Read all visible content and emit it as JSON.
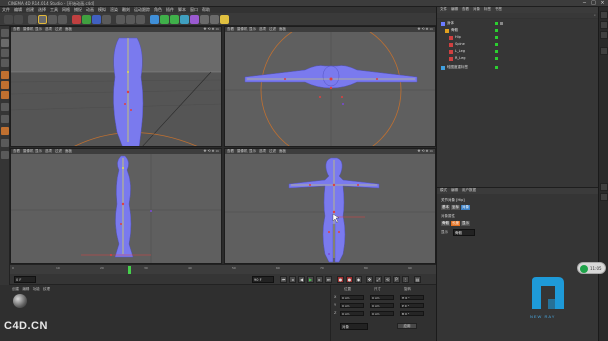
{
  "window": {
    "title": "CINEMA 4D R14.014 Studio - [开始动画.c4d]",
    "controls": [
      "−",
      "□",
      "×"
    ]
  },
  "menubar": [
    "文件",
    "编辑",
    "创建",
    "选择",
    "工具",
    "网格",
    "捕捉",
    "动画",
    "模拟",
    "渲染",
    "雕刻",
    "运动跟踪",
    "角色",
    "插件",
    "脚本",
    "窗口",
    "帮助"
  ],
  "viewports": [
    {
      "name": "透视视图",
      "menus": [
        "查看",
        "摄像机",
        "显示",
        "选项",
        "过滤",
        "面板"
      ]
    },
    {
      "name": "顶视图",
      "menus": [
        "查看",
        "摄像机",
        "显示",
        "选项",
        "过滤",
        "面板"
      ]
    },
    {
      "name": "右视图",
      "menus": [
        "查看",
        "摄像机",
        "显示",
        "选项",
        "过滤",
        "面板"
      ]
    },
    {
      "name": "正视图",
      "menus": [
        "查看",
        "摄像机",
        "显示",
        "选项",
        "过滤",
        "面板"
      ]
    }
  ],
  "timeline": {
    "ticks": [
      "0",
      "10",
      "20",
      "30",
      "40",
      "50",
      "60",
      "70",
      "80",
      "90"
    ],
    "playhead_fraction": 0.28,
    "start_field": "0 F",
    "end_field": "90 F",
    "current_field": "0 F"
  },
  "material_manager": {
    "menus": [
      "创建",
      "编辑",
      "功能",
      "纹理"
    ]
  },
  "coordinates": {
    "headers": [
      "位置",
      "尺寸",
      "旋转"
    ],
    "rows": [
      {
        "axis": "X",
        "pos": "0 cm",
        "size": "0 cm",
        "rot": "H 0 °"
      },
      {
        "axis": "Y",
        "pos": "0 cm",
        "size": "0 cm",
        "rot": "P 0 °"
      },
      {
        "axis": "Z",
        "pos": "0 cm",
        "size": "0 cm",
        "rot": "B 0 °"
      }
    ],
    "mode": "对象",
    "apply": "应用"
  },
  "objects_panel": {
    "tabs": [
      "文件",
      "编辑",
      "查看",
      "对象",
      "标签",
      "书签"
    ],
    "items": [
      {
        "name": "身体",
        "indent": 0,
        "color": "#6b7cff"
      },
      {
        "name": "骨骼",
        "indent": 1,
        "color": "#e0a020"
      },
      {
        "name": "Hip",
        "indent": 2,
        "color": "#d04040"
      },
      {
        "name": "Spine",
        "indent": 2,
        "color": "#d04040"
      },
      {
        "name": "L_Leg",
        "indent": 2,
        "color": "#d04040"
      },
      {
        "name": "R_Leg",
        "indent": 2,
        "color": "#d04040"
      },
      {
        "name": "蛙图度重标签",
        "indent": 0,
        "color": "#40a0e0"
      }
    ]
  },
  "attributes_panel": {
    "tabs": [
      "模式",
      "编辑",
      "用户数据"
    ],
    "header": "关节对象 [Hip]",
    "subtabs": [
      "基本",
      "坐标",
      "对象"
    ],
    "section": "对象属性",
    "labels": [
      "骨骼",
      "长度",
      "显示"
    ],
    "display_value": "骨骼"
  },
  "float_widget": {
    "text": "11:05"
  },
  "watermark": "C4D.CN",
  "logo": {
    "text": "NEW RAY",
    "color": "#1e9ad8"
  },
  "colors": {
    "mesh": "#7a7aee",
    "bone": "#e3e14a",
    "joint": "#e04040",
    "accent": "#1e9ad8"
  }
}
